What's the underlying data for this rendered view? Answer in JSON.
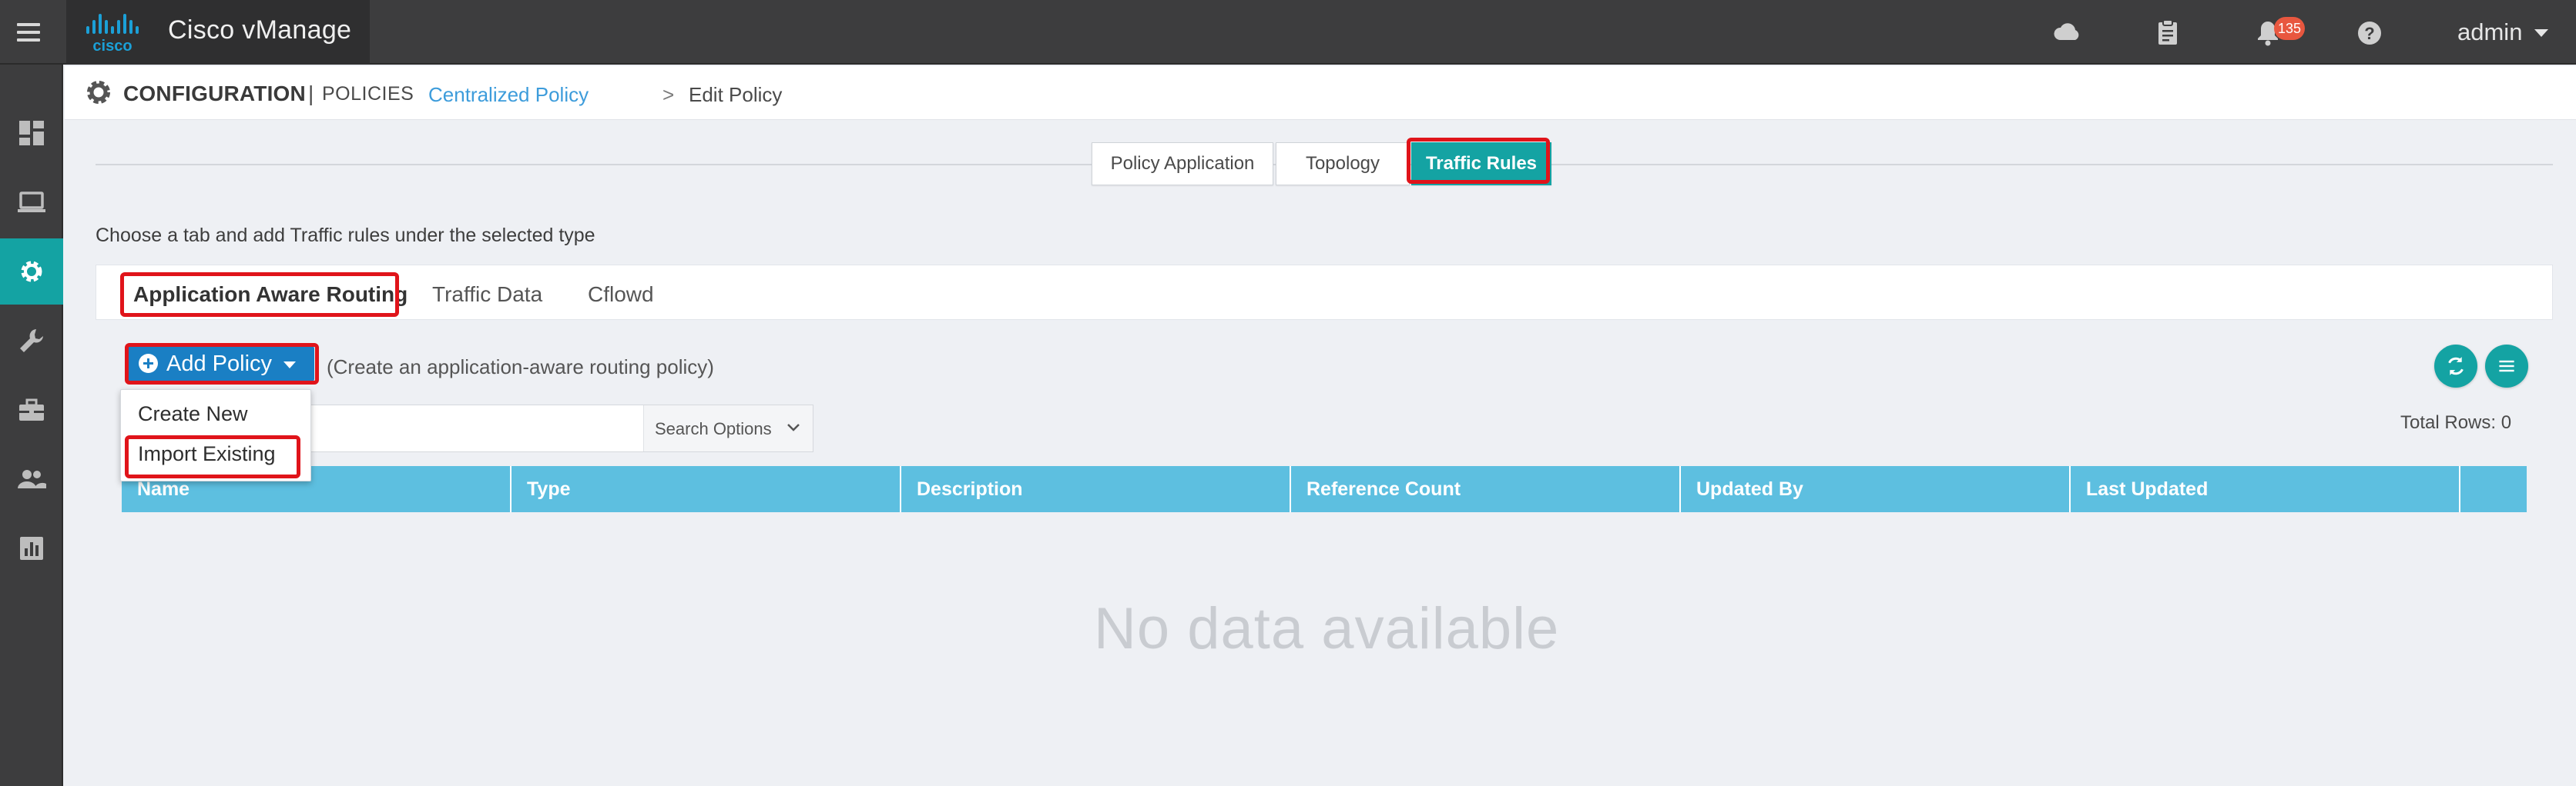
{
  "app": {
    "title": "Cisco vManage",
    "logo_text": "cisco",
    "user": "admin",
    "notification_count": "135"
  },
  "topbar_icons": [
    "hamburger-icon",
    "cloud-icon",
    "clipboard-icon",
    "bell-icon",
    "help-icon"
  ],
  "sidebar": {
    "items": [
      {
        "name": "dashboard-icon"
      },
      {
        "name": "monitor-icon"
      },
      {
        "name": "configuration-gear-icon",
        "active": true
      },
      {
        "name": "tools-wrench-icon"
      },
      {
        "name": "maintenance-toolbox-icon"
      },
      {
        "name": "administration-users-icon"
      },
      {
        "name": "analytics-chart-icon"
      }
    ]
  },
  "header": {
    "title": "CONFIGURATION",
    "separator": "|",
    "subtitle": "POLICIES",
    "breadcrumb_link": "Centralized Policy",
    "breadcrumb_sep": ">",
    "breadcrumb_current": "Edit Policy"
  },
  "top_tabs": [
    {
      "label": "Policy Application"
    },
    {
      "label": "Topology"
    },
    {
      "label": "Traffic Rules",
      "active": true
    }
  ],
  "instructions": "Choose a tab and add Traffic rules under the selected type",
  "sub_tabs": [
    {
      "label": "Application Aware Routing",
      "active": true
    },
    {
      "label": "Traffic Data"
    },
    {
      "label": "Cflowd"
    }
  ],
  "add_policy": {
    "label": "Add Policy",
    "hint": "(Create an application-aware routing policy)",
    "menu": [
      {
        "label": "Create New"
      },
      {
        "label": "Import Existing"
      }
    ]
  },
  "search": {
    "placeholder": "",
    "options_label": "Search Options"
  },
  "table": {
    "total_rows": "Total Rows: 0",
    "columns": [
      "Name",
      "Type",
      "Description",
      "Reference Count",
      "Updated By",
      "Last Updated"
    ],
    "empty_text": "No data available"
  },
  "colors": {
    "accent_teal": "#14a3a3",
    "table_header": "#5dbfe0",
    "primary_blue": "#1a7fc4",
    "highlight_red": "#e0141a",
    "badge": "#e8573f"
  }
}
